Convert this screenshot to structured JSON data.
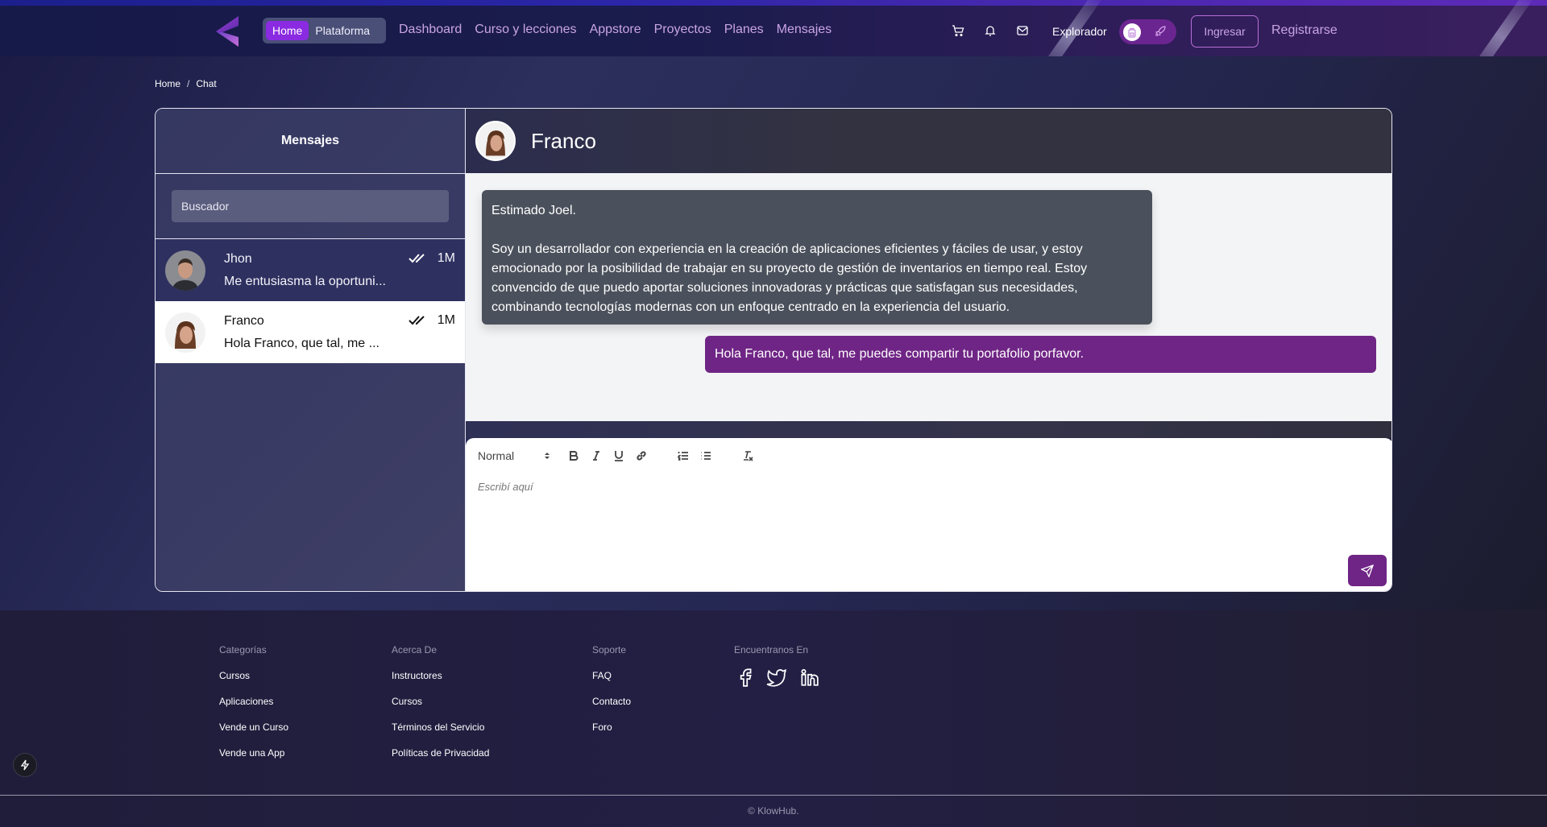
{
  "nav": {
    "home_label": "Home",
    "platform_label": "Plataforma",
    "links": [
      "Dashboard",
      "Curso y lecciones",
      "Appstore",
      "Proyectos",
      "Planes",
      "Mensajes"
    ],
    "icons": [
      "cart-icon",
      "bell-icon",
      "mail-icon"
    ],
    "role_label": "Explorador",
    "login_label": "Ingresar",
    "register_label": "Registrarse"
  },
  "breadcrumb": [
    "Home",
    "/",
    "Chat"
  ],
  "sidebar": {
    "title": "Mensajes",
    "search_placeholder": "Buscador",
    "conversations": [
      {
        "name": "Jhon",
        "preview": "Me entusiasma la oportuni...",
        "time": "1M",
        "read": true,
        "active": false
      },
      {
        "name": "Franco",
        "preview": "Hola Franco, que tal, me ...",
        "time": "1M",
        "read": true,
        "active": true
      }
    ]
  },
  "chat": {
    "contact_name": "Franco",
    "messages": [
      {
        "direction": "incoming",
        "greeting": "Estimado Joel.",
        "body": "Soy un desarrollador con experiencia en la creación de aplicaciones eficientes y fáciles de usar, y estoy emocionado por la posibilidad de trabajar en su proyecto de gestión de inventarios en tiempo real. Estoy convencido de que puedo aportar soluciones innovadoras y prácticas que satisfagan sus necesidades, combinando tecnologías modernas con un enfoque centrado en la experiencia del usuario."
      },
      {
        "direction": "outgoing",
        "body": "Hola Franco, que tal, me puedes compartir tu portafolio porfavor."
      }
    ],
    "editor": {
      "format_value": "Normal",
      "placeholder": "Escribí aquí",
      "toolbar": [
        "bold",
        "italic",
        "underline",
        "link",
        "ordered-list",
        "bullet-list",
        "clear-format"
      ]
    }
  },
  "footer": {
    "columns": [
      {
        "title": "Categorías",
        "items": [
          "Cursos",
          "Aplicaciones",
          "Vende un Curso",
          "Vende una App"
        ]
      },
      {
        "title": "Acerca De",
        "items": [
          "Instructores",
          "Cursos",
          "Términos del Servicio",
          "Políticas de Privacidad"
        ]
      },
      {
        "title": "Soporte",
        "items": [
          "FAQ",
          "Contacto",
          "Foro"
        ]
      },
      {
        "title": "Encuentranos En",
        "social": [
          "facebook-icon",
          "twitter-icon",
          "linkedin-icon"
        ]
      }
    ],
    "copyright": "© KlowHub."
  },
  "colors": {
    "accent": "#8a2be2",
    "bubble_out": "#6f2585",
    "bubble_in": "#4b515c",
    "nav_link": "#c9a4e4"
  }
}
